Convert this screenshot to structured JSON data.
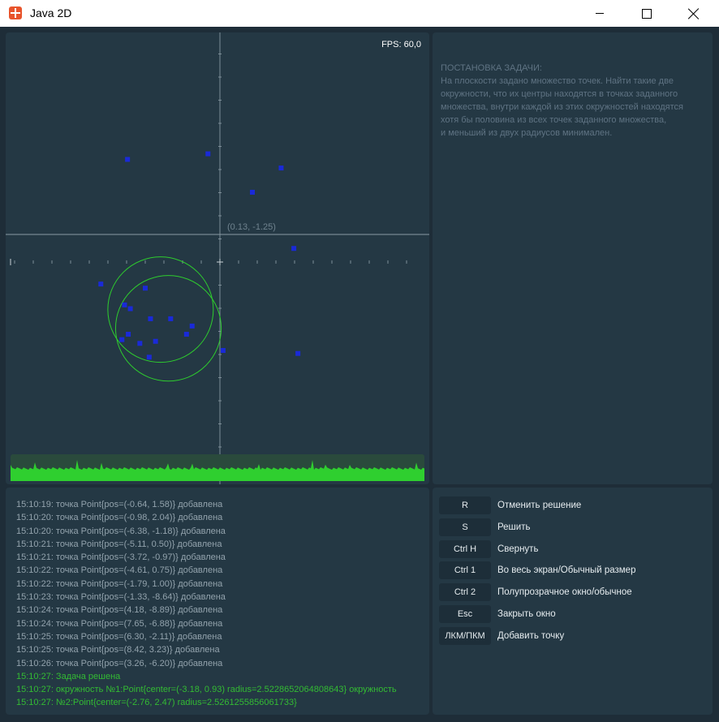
{
  "window": {
    "title": "Java 2D"
  },
  "canvas": {
    "fps": "FPS: 60,0",
    "cursor_coord": "(0.13, -1.25)",
    "points": [
      [
        -4.95,
        5.5
      ],
      [
        -0.64,
        5.8
      ],
      [
        1.74,
        3.74
      ],
      [
        3.28,
        5.04
      ],
      [
        3.96,
        0.73
      ],
      [
        -6.38,
        -1.18
      ],
      [
        -4.0,
        -1.4
      ],
      [
        -5.11,
        -2.3
      ],
      [
        -4.8,
        -2.5
      ],
      [
        -3.72,
        -3.04
      ],
      [
        -2.64,
        -3.04
      ],
      [
        -4.91,
        -3.87
      ],
      [
        -5.25,
        -4.16
      ],
      [
        -4.29,
        -4.36
      ],
      [
        -3.45,
        -4.25
      ],
      [
        -3.79,
        -5.1
      ],
      [
        -1.79,
        -3.87
      ],
      [
        -1.49,
        -3.43
      ],
      [
        0.17,
        -4.74
      ],
      [
        4.18,
        -4.9
      ]
    ],
    "circles": [
      {
        "cx": -3.18,
        "cy": -2.55,
        "r": 2.5229
      },
      {
        "cx": -2.76,
        "cy": -3.55,
        "r": 2.5261
      }
    ],
    "line_color": "#2ecc2e",
    "point_color": "#1a2ad8"
  },
  "description": {
    "title": "ПОСТАНОВКА ЗАДАЧИ:",
    "lines": [
      "На плоскости задано множество точек. Найти такие две",
      "окружности, что их центры находятся в точках заданного",
      "множества, внутри каждой из этих окружностей находятся",
      "хотя бы половина из всех точек заданного множества,",
      "и меньший из двух радиусов минимален."
    ]
  },
  "log": [
    {
      "text": "15:10:19: точка Point{pos=(-0.64, 1.58)} добавлена",
      "ok": false
    },
    {
      "text": "15:10:20: точка Point{pos=(-0.98, 2.04)} добавлена",
      "ok": false
    },
    {
      "text": "15:10:20: точка Point{pos=(-6.38, -1.18)} добавлена",
      "ok": false
    },
    {
      "text": "15:10:21: точка Point{pos=(-5.11, 0.50)} добавлена",
      "ok": false
    },
    {
      "text": "15:10:21: точка Point{pos=(-3.72, -0.97)} добавлена",
      "ok": false
    },
    {
      "text": "15:10:22: точка Point{pos=(-4.61, 0.75)} добавлена",
      "ok": false
    },
    {
      "text": "15:10:22: точка Point{pos=(-1.79, 1.00)} добавлена",
      "ok": false
    },
    {
      "text": "15:10:23: точка Point{pos=(-1.33, -8.64)} добавлена",
      "ok": false
    },
    {
      "text": "15:10:24: точка Point{pos=(4.18, -8.89)} добавлена",
      "ok": false
    },
    {
      "text": "15:10:24: точка Point{pos=(7.65, -6.88)} добавлена",
      "ok": false
    },
    {
      "text": "15:10:25: точка Point{pos=(6.30, -2.11)} добавлена",
      "ok": false
    },
    {
      "text": "15:10:25: точка Point{pos=(8.42, 3.23)} добавлена",
      "ok": false
    },
    {
      "text": "15:10:26: точка Point{pos=(3.26, -6.20)} добавлена",
      "ok": false
    },
    {
      "text": "15:10:27: Задача решена",
      "ok": true
    },
    {
      "text": "15:10:27: окружность №1:Point{center=(-3.18, 0.93) radius=2.5228652064808643} окружность",
      "ok": true
    },
    {
      "text": "15:10:27: №2:Point{center=(-2.76, 2.47) radius=2.5261255856061733}",
      "ok": true
    }
  ],
  "shortcuts": [
    {
      "key": "R",
      "label": "Отменить решение"
    },
    {
      "key": "S",
      "label": "Решить"
    },
    {
      "key": "Ctrl H",
      "label": "Свернуть"
    },
    {
      "key": "Ctrl 1",
      "label": "Во весь экран/Обычный размер"
    },
    {
      "key": "Ctrl 2",
      "label": "Полупрозрачное окно/обычное"
    },
    {
      "key": "Esc",
      "label": "Закрыть окно"
    },
    {
      "key": "ЛКМ/ПКМ",
      "label": "Добавить точку"
    }
  ]
}
